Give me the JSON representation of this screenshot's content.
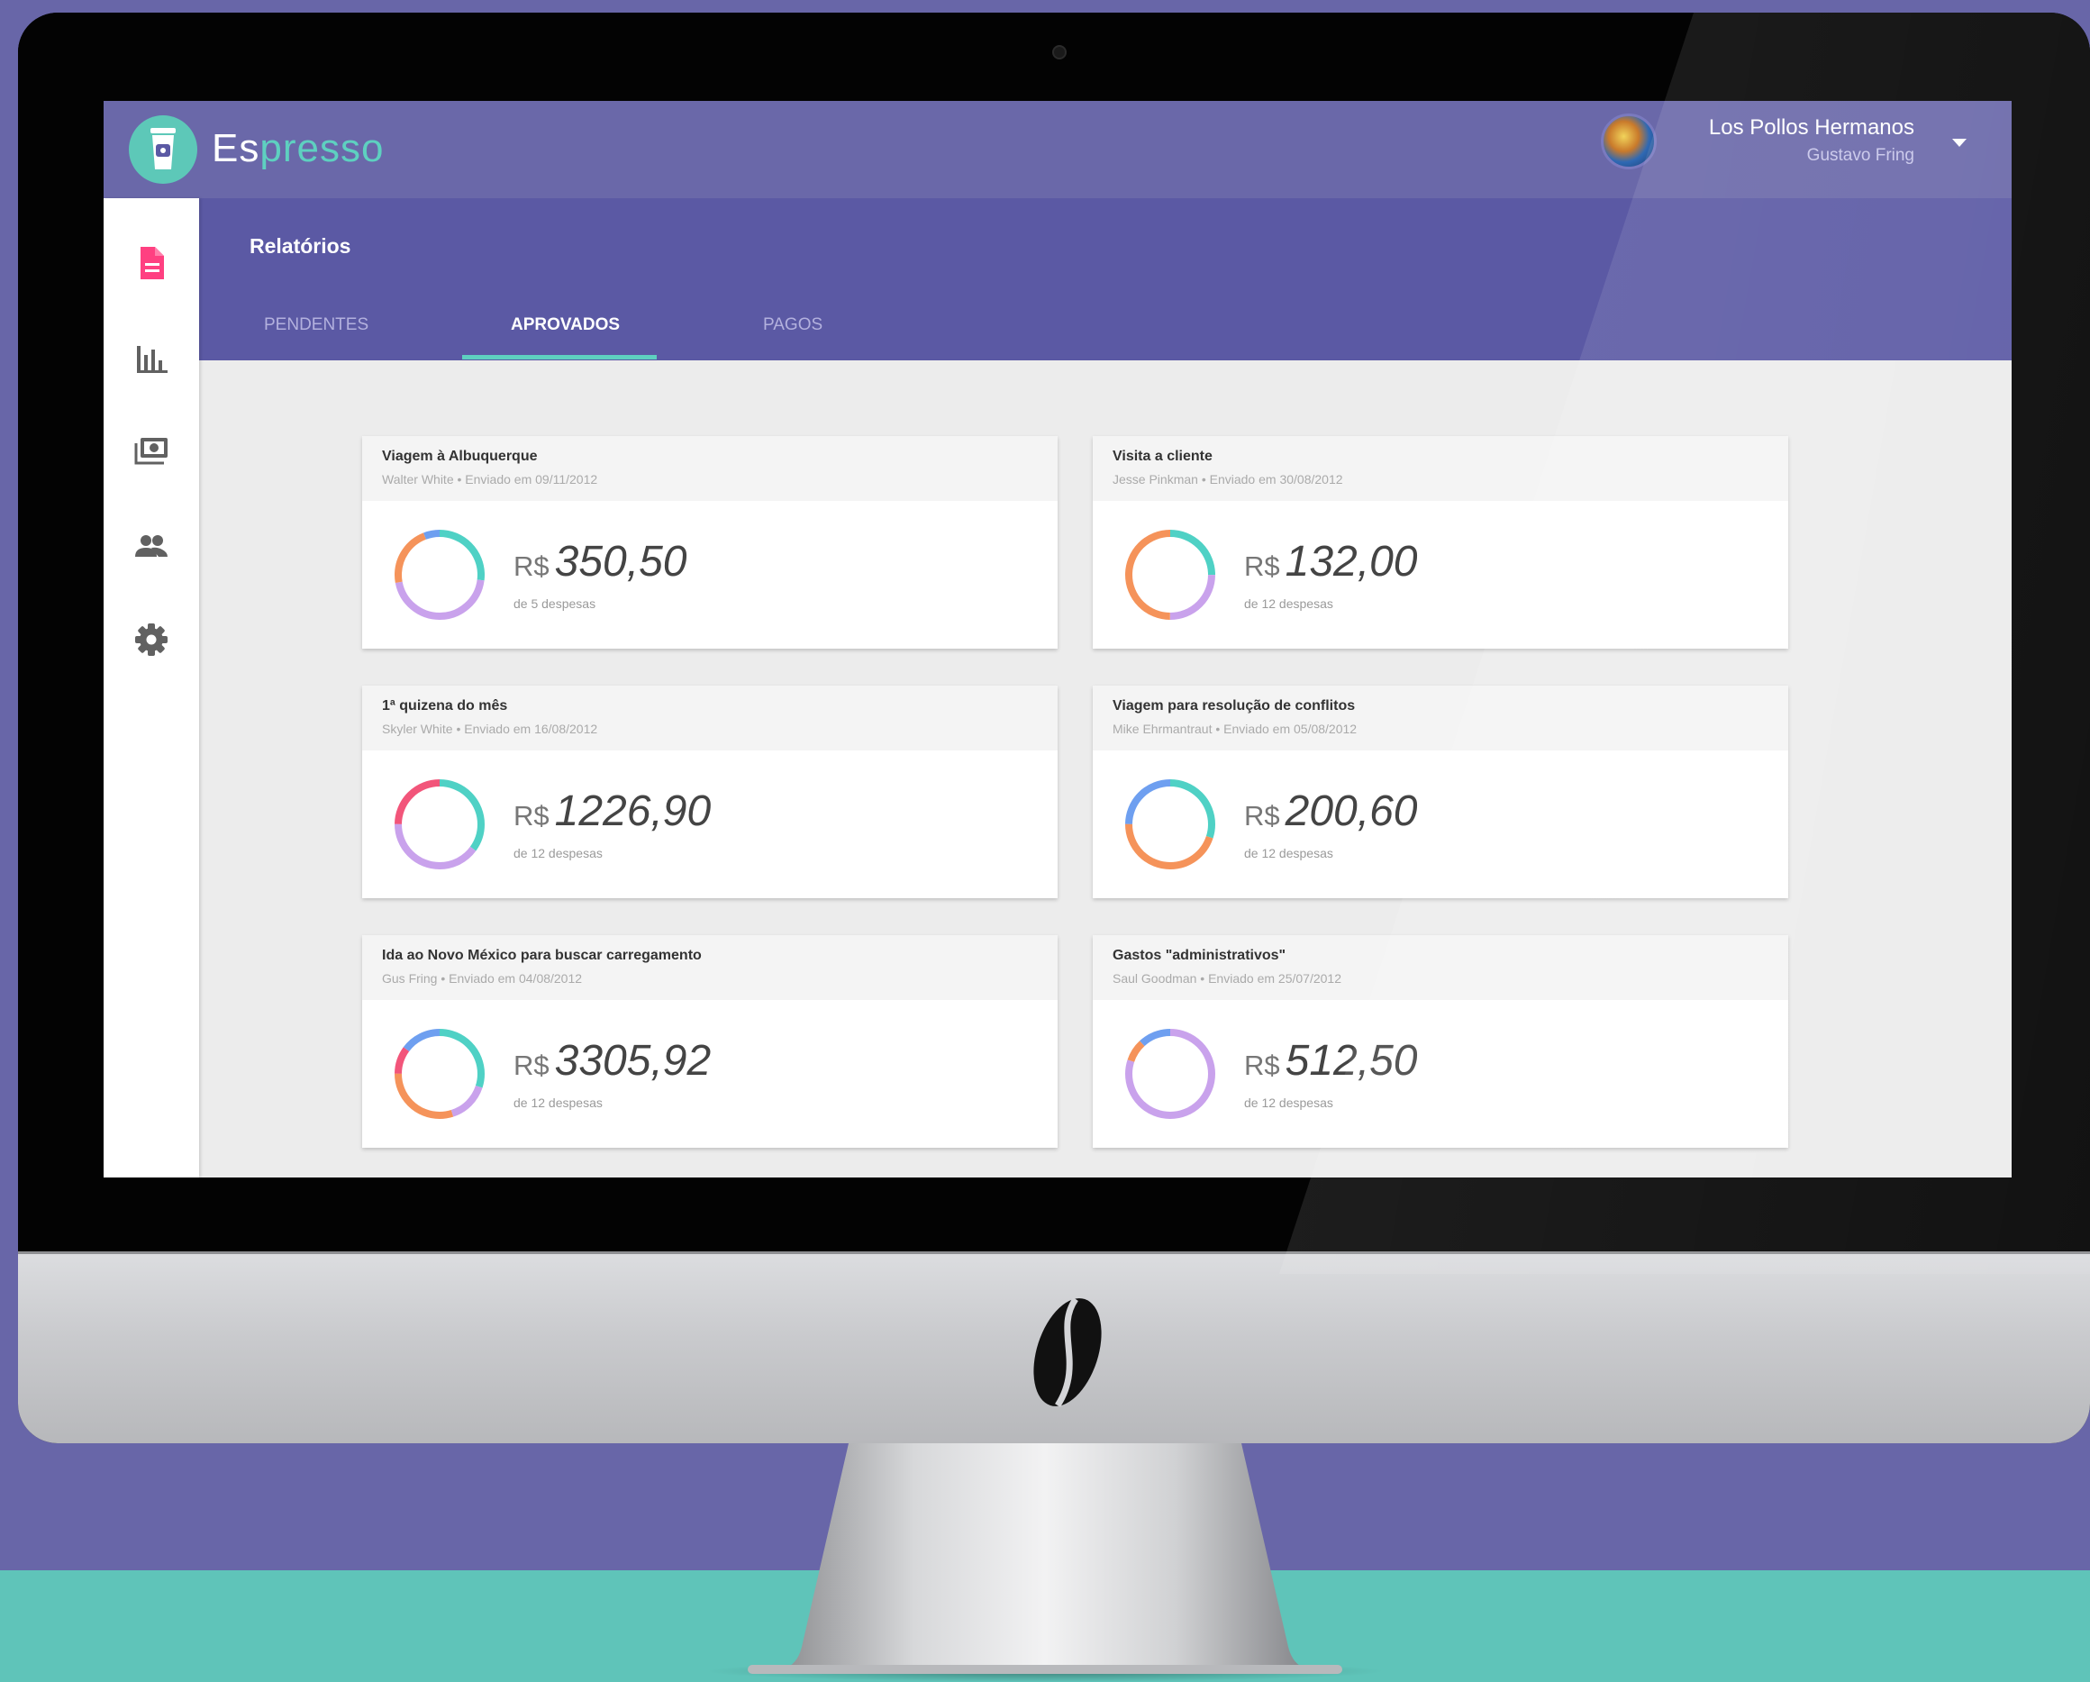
{
  "app": {
    "name_prefix": "Es",
    "name_suffix": "presso",
    "company": "Los Pollos Hermanos",
    "user": "Gustavo Fring"
  },
  "sidebar": {
    "items": [
      {
        "icon": "report-icon",
        "color": "#ff4081",
        "active": true
      },
      {
        "icon": "bar-chart-icon",
        "color": "#616161",
        "active": false
      },
      {
        "icon": "money-icon",
        "color": "#616161",
        "active": false
      },
      {
        "icon": "people-icon",
        "color": "#616161",
        "active": false
      },
      {
        "icon": "gear-icon",
        "color": "#616161",
        "active": false
      }
    ]
  },
  "page": {
    "title": "Relatórios",
    "tabs": [
      {
        "label": "PENDENTES",
        "active": false
      },
      {
        "label": "APROVADOS",
        "active": true
      },
      {
        "label": "PAGOS",
        "active": false
      }
    ]
  },
  "colors": {
    "header": "#6a68a9",
    "subheader": "#5b59a4",
    "accent": "#5ed0c0",
    "ring_teal": "#4fd1c5",
    "ring_orange": "#f5935a",
    "ring_purple": "#c9a2ec",
    "ring_pink": "#f2557a",
    "ring_blue": "#6e9ff0"
  },
  "reports": [
    {
      "title": "Viagem à Albuquerque",
      "author": "Walter White",
      "sent": "Enviado em 09/11/2012",
      "currency": "R$",
      "amount": "350,50",
      "count": "de 5 despesas",
      "ring": [
        {
          "color": "#4fd1c5",
          "share": 0.27
        },
        {
          "color": "#c9a2ec",
          "share": 0.45
        },
        {
          "color": "#f5935a",
          "share": 0.22
        },
        {
          "color": "#6e9ff0",
          "share": 0.06
        }
      ]
    },
    {
      "title": "Visita a cliente",
      "author": "Jesse Pinkman",
      "sent": "Enviado em 30/08/2012",
      "currency": "R$",
      "amount": "132,00",
      "count": "de 12 despesas",
      "ring": [
        {
          "color": "#4fd1c5",
          "share": 0.25
        },
        {
          "color": "#c9a2ec",
          "share": 0.25
        },
        {
          "color": "#f5935a",
          "share": 0.5
        }
      ]
    },
    {
      "title": "1ª quizena do mês",
      "author": "Skyler White",
      "sent": "Enviado em 16/08/2012",
      "currency": "R$",
      "amount": "1226,90",
      "count": "de 12 despesas",
      "ring": [
        {
          "color": "#4fd1c5",
          "share": 0.35
        },
        {
          "color": "#c9a2ec",
          "share": 0.4
        },
        {
          "color": "#f2557a",
          "share": 0.25
        }
      ]
    },
    {
      "title": "Viagem para resolução de conflitos",
      "author": "Mike Ehrmantraut",
      "sent": "Enviado em 05/08/2012",
      "currency": "R$",
      "amount": "200,60",
      "count": "de 12 despesas",
      "ring": [
        {
          "color": "#4fd1c5",
          "share": 0.3
        },
        {
          "color": "#f5935a",
          "share": 0.45
        },
        {
          "color": "#6e9ff0",
          "share": 0.25
        }
      ]
    },
    {
      "title": "Ida ao Novo México para buscar carregamento",
      "author": "Gus Fring",
      "sent": "Enviado em 04/08/2012",
      "currency": "R$",
      "amount": "3305,92",
      "count": "de 12 despesas",
      "ring": [
        {
          "color": "#4fd1c5",
          "share": 0.3
        },
        {
          "color": "#c9a2ec",
          "share": 0.15
        },
        {
          "color": "#f5935a",
          "share": 0.3
        },
        {
          "color": "#f2557a",
          "share": 0.1
        },
        {
          "color": "#6e9ff0",
          "share": 0.15
        }
      ]
    },
    {
      "title": "Gastos \"administrativos\"",
      "author": "Saul Goodman",
      "sent": "Enviado em 25/07/2012",
      "currency": "R$",
      "amount": "512,50",
      "count": "de 12 despesas",
      "ring": [
        {
          "color": "#c9a2ec",
          "share": 0.8
        },
        {
          "color": "#f5935a",
          "share": 0.08
        },
        {
          "color": "#6e9ff0",
          "share": 0.12
        }
      ]
    }
  ]
}
